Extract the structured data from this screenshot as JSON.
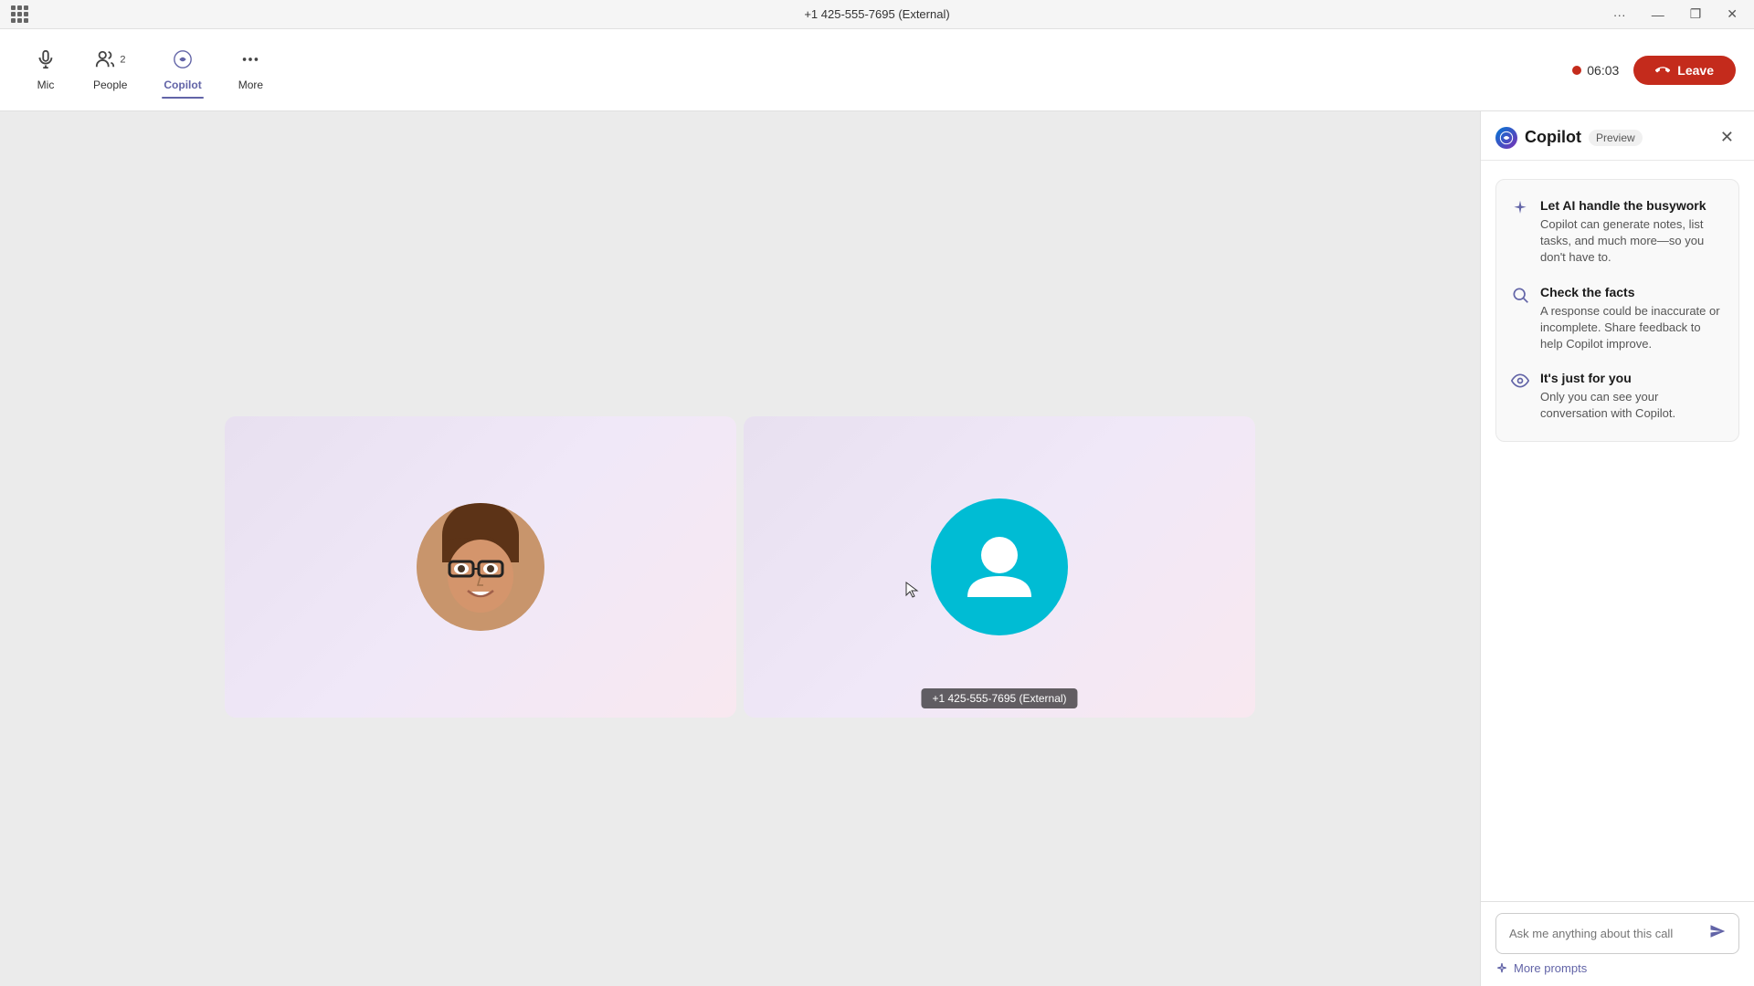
{
  "titlebar": {
    "title": "+1 425-555-7695 (External)",
    "controls": {
      "more": "···",
      "minimize": "—",
      "restore": "❐",
      "close": "✕"
    }
  },
  "toolbar": {
    "mic": {
      "label": "Mic",
      "icon": "🎙"
    },
    "people": {
      "label": "People",
      "icon": "👥",
      "count": "2"
    },
    "copilot": {
      "label": "Copilot",
      "icon": "✦"
    },
    "more": {
      "label": "More",
      "icon": "···"
    },
    "recording": {
      "time": "06:03"
    },
    "leave": "Leave"
  },
  "video": {
    "tile_external_label": "+1 425-555-7695 (External)"
  },
  "copilot": {
    "title": "Copilot",
    "preview_badge": "Preview",
    "close_icon": "✕",
    "info_items": [
      {
        "title": "Let AI handle the busywork",
        "body": "Copilot can generate notes, list tasks, and much more—so you don't have to."
      },
      {
        "title": "Check the facts",
        "body": "A response could be inaccurate or incomplete. Share feedback to help Copilot improve."
      },
      {
        "title": "It's just for you",
        "body": "Only you can see your conversation with Copilot."
      }
    ],
    "input_placeholder": "Ask me anything about this call",
    "more_prompts_label": "More prompts"
  }
}
